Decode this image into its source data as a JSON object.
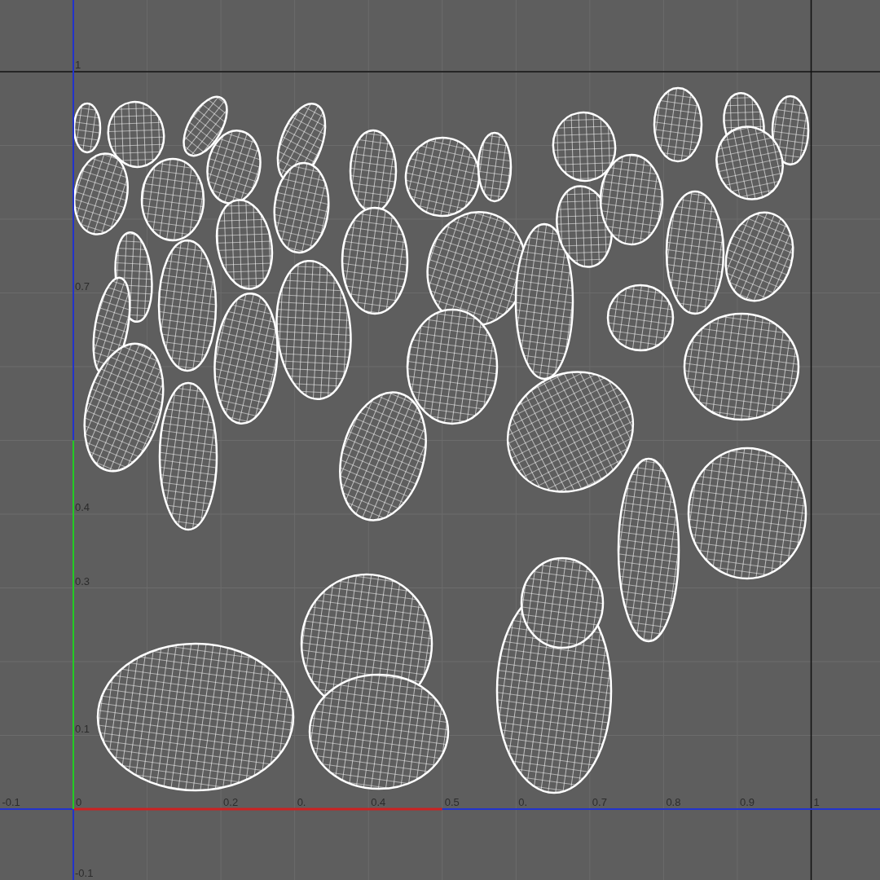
{
  "uv_editor": {
    "x_axis_labels": [
      "-0.1",
      "0",
      "0.2",
      "0.",
      "0.4",
      "0.5",
      "0.",
      "0.7",
      "0.8",
      "0.9",
      "1"
    ],
    "y_axis_labels": [
      "1",
      "0.7",
      "0.4",
      "0.3",
      "0.1",
      "-0.1"
    ]
  }
}
